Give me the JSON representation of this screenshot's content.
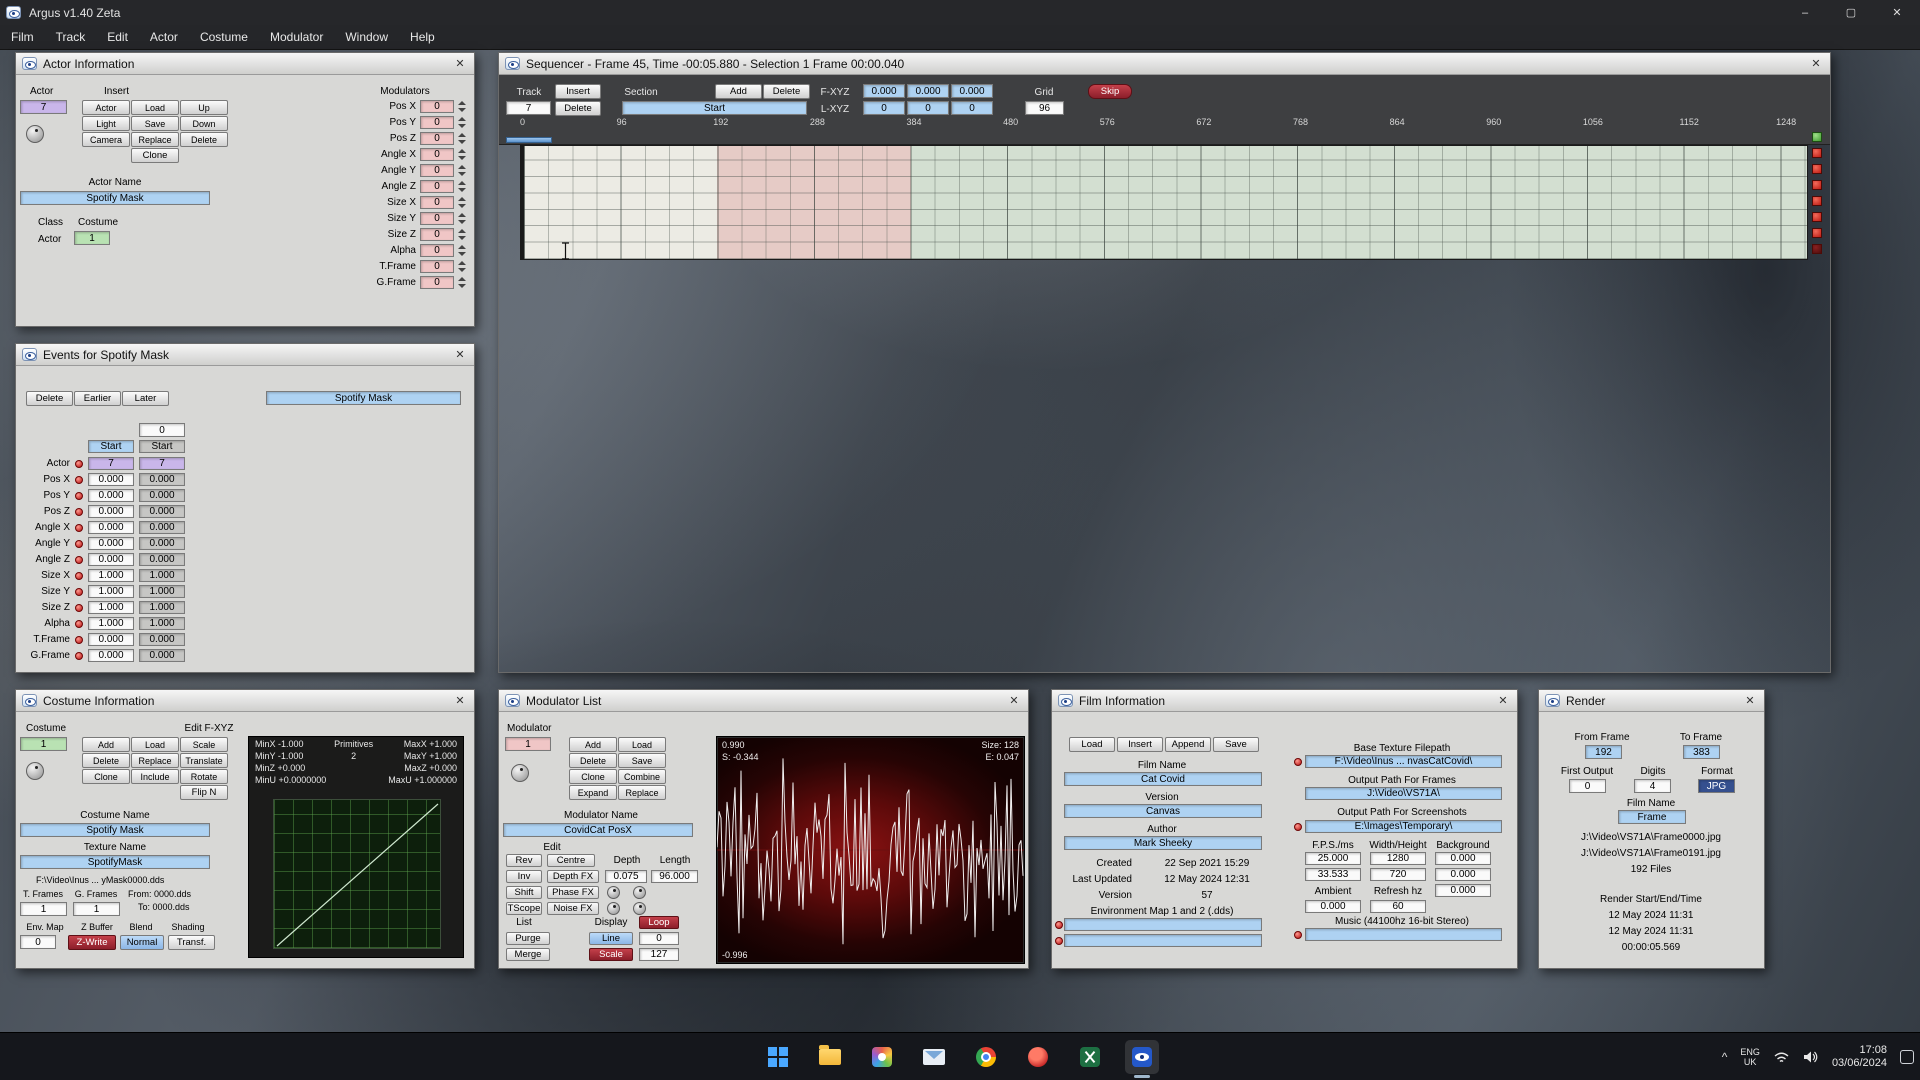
{
  "ui": {
    "close": "✕",
    "min": "–",
    "max": "▢",
    "chevron": "^"
  },
  "app": {
    "title": "Argus v1.40 Zeta",
    "menus": [
      "Film",
      "Track",
      "Edit",
      "Actor",
      "Costume",
      "Modulator",
      "Window",
      "Help"
    ]
  },
  "colors": {
    "field_blue": "#aed2f2",
    "field_pink": "#f0c6c6",
    "field_purple": "#c9b6ea",
    "field_green": "#b9e2b3",
    "button_red": "#a32430",
    "button_navy": "#35508f",
    "led_red": "#d42222"
  },
  "actor_info": {
    "title": "Actor Information",
    "actor_label": "Actor",
    "actor_value": "7",
    "insert_label": "Insert",
    "insert_buttons": [
      "Actor",
      "Load",
      "Up",
      "Light",
      "Save",
      "Down",
      "Camera",
      "Replace",
      "Delete"
    ],
    "clone_button": "Clone",
    "actor_name_label": "Actor Name",
    "actor_name_value": "Spotify Mask",
    "class_label": "Class",
    "costume_label": "Costume",
    "class_value": "Actor",
    "costume_value": "1",
    "modulators_label": "Modulators",
    "modulators": [
      {
        "label": "Pos X",
        "value": "0"
      },
      {
        "label": "Pos Y",
        "value": "0"
      },
      {
        "label": "Pos Z",
        "value": "0"
      },
      {
        "label": "Angle X",
        "value": "0"
      },
      {
        "label": "Angle Y",
        "value": "0"
      },
      {
        "label": "Angle Z",
        "value": "0"
      },
      {
        "label": "Size X",
        "value": "0"
      },
      {
        "label": "Size Y",
        "value": "0"
      },
      {
        "label": "Size Z",
        "value": "0"
      },
      {
        "label": "Alpha",
        "value": "0"
      },
      {
        "label": "T.Frame",
        "value": "0"
      },
      {
        "label": "G.Frame",
        "value": "0"
      }
    ]
  },
  "sequencer": {
    "title": "Sequencer - Frame 45, Time -00:05.880 - Selection 1 Frame 00:00.040",
    "track_label": "Track",
    "track_value": "7",
    "insert_button": "Insert",
    "delete_button": "Delete",
    "section_label": "Section",
    "section_value": "Start",
    "add_button": "Add",
    "delete_section_button": "Delete",
    "fxyz_label": "F-XYZ",
    "fxyz": [
      "0.000",
      "0.000",
      "0.000"
    ],
    "lxyz_label": "L-XYZ",
    "lxyz": [
      "0",
      "0",
      "0"
    ],
    "grid_label": "Grid",
    "grid_value": "96",
    "skip_button": "Skip",
    "ruler": [
      "0",
      "96",
      "192",
      "288",
      "384",
      "480",
      "576",
      "672",
      "768",
      "864",
      "960",
      "1056",
      "1152",
      "1248"
    ]
  },
  "events": {
    "title": "Events for Spotify Mask",
    "delete_button": "Delete",
    "earlier_button": "Earlier",
    "later_button": "Later",
    "mask_name": "Spotify Mask",
    "offset_value": "0",
    "col1_header": "Start",
    "col2_header": "Start",
    "actor_row": {
      "label": "Actor",
      "start1": "7",
      "start2": "7"
    },
    "rows": [
      {
        "label": "Pos X",
        "start1": "0.000",
        "start2": "0.000"
      },
      {
        "label": "Pos Y",
        "start1": "0.000",
        "start2": "0.000"
      },
      {
        "label": "Pos Z",
        "start1": "0.000",
        "start2": "0.000"
      },
      {
        "label": "Angle X",
        "start1": "0.000",
        "start2": "0.000"
      },
      {
        "label": "Angle Y",
        "start1": "0.000",
        "start2": "0.000"
      },
      {
        "label": "Angle Z",
        "start1": "0.000",
        "start2": "0.000"
      },
      {
        "label": "Size X",
        "start1": "1.000",
        "start2": "1.000"
      },
      {
        "label": "Size Y",
        "start1": "1.000",
        "start2": "1.000"
      },
      {
        "label": "Size Z",
        "start1": "1.000",
        "start2": "1.000"
      },
      {
        "label": "Alpha",
        "start1": "1.000",
        "start2": "1.000"
      },
      {
        "label": "T.Frame",
        "start1": "0.000",
        "start2": "0.000"
      },
      {
        "label": "G.Frame",
        "start1": "0.000",
        "start2": "0.000"
      }
    ]
  },
  "costume_info": {
    "title": "Costume Information",
    "costume_label": "Costume",
    "costume_value": "1",
    "buttons": [
      "Add",
      "Load",
      "Scale",
      "Delete",
      "Replace",
      "Translate",
      "Clone",
      "Include",
      "Rotate"
    ],
    "flip_button": "Flip N",
    "edit_label": "Edit F-XYZ",
    "bounds": {
      "minx": "MinX -1.000",
      "primitives_label": "Primitives",
      "maxx": "MaxX +1.000",
      "miny": "MinY -1.000",
      "primitives_value": "2",
      "maxy": "MaxY +1.000",
      "minz": "MinZ +0.000",
      "maxz": "MaxZ +0.000",
      "minu": "MinU +0.0000000",
      "maxu": "MaxU +1.000000"
    },
    "costume_name_label": "Costume Name",
    "costume_name_value": "Spotify Mask",
    "texture_name_label": "Texture Name",
    "texture_name_value": "SpotifyMask",
    "texture_path": "F:\\Video\\Inus ... yMask0000.dds",
    "t_frames_label": "T. Frames",
    "g_frames_label": "G. Frames",
    "from_label": "From: 0000.dds",
    "to_label": "To: 0000.dds",
    "t_frames_value": "1",
    "g_frames_value": "1",
    "env_map_label": "Env. Map",
    "z_buffer_label": "Z Buffer",
    "blend_label": "Blend",
    "shading_label": "Shading",
    "env_map_value": "0",
    "z_write_button": "Z-Write",
    "normal_button": "Normal",
    "transf_button": "Transf."
  },
  "modulator_list": {
    "title": "Modulator List",
    "modulator_label": "Modulator",
    "modulator_value": "1",
    "buttons": [
      "Add",
      "Load",
      "Delete",
      "Save",
      "Clone",
      "Combine",
      "Expand",
      "Replace"
    ],
    "modulator_name_label": "Modulator Name",
    "modulator_name_value": "CovidCat PosX",
    "edit_label": "Edit",
    "rev_button": "Rev",
    "centre_button": "Centre",
    "depth_label": "Depth",
    "length_label": "Length",
    "inv_button": "Inv",
    "depth_fx_button": "Depth FX",
    "depth_value": "0.075",
    "length_value": "96.000",
    "shift_button": "Shift",
    "phase_fx_button": "Phase FX",
    "tscope_button": "TScope",
    "noise_fx_button": "Noise FX",
    "list_label": "List",
    "display_label": "Display",
    "loop_button": "Loop",
    "purge_button": "Purge",
    "line_button": "Line",
    "line_value": "0",
    "merge_button": "Merge",
    "scale_button": "Scale",
    "scale_value": "127",
    "wave": {
      "top": "0.990",
      "start": "S: -0.344",
      "size": "Size: 128",
      "end": "E: 0.047",
      "bottom": "-0.996"
    }
  },
  "film_info": {
    "title": "Film Information",
    "buttons": [
      "Load",
      "Insert",
      "Append",
      "Save"
    ],
    "film_name_label": "Film Name",
    "film_name_value": "Cat Covid",
    "version_name_label": "Version",
    "version_name_value": "Canvas",
    "author_label": "Author",
    "author_value": "Mark Sheeky",
    "created_label": "Created",
    "created_value": "22 Sep 2021 15:29",
    "updated_label": "Last Updated",
    "updated_value": "12 May 2024 12:31",
    "version_label": "Version",
    "version_value": "57",
    "env_map_label": "Environment Map 1 and 2 (.dds)",
    "base_texture_label": "Base Texture Filepath",
    "base_texture_value": "F:\\Video\\Inus ... nvasCatCovid\\",
    "frames_path_label": "Output Path For Frames",
    "frames_path_value": "J:\\Video\\VS71A\\",
    "screenshots_path_label": "Output Path For Screenshots",
    "screenshots_path_value": "E:\\Images\\Temporary\\",
    "fps_label": "F.P.S./ms",
    "size_label": "Width/Height",
    "background_label": "Background",
    "fps_value": "25.000",
    "width_value": "1280",
    "bg1_value": "0.000",
    "ms_value": "33.533",
    "height_value": "720",
    "bg2_value": "0.000",
    "ambient_label": "Ambient",
    "refresh_label": "Refresh hz",
    "bg3_value": "0.000",
    "ambient_value": "0.000",
    "refresh_value": "60",
    "music_label": "Music (44100hz 16-bit Stereo)"
  },
  "render": {
    "title": "Render",
    "from_label": "From Frame",
    "to_label": "To Frame",
    "from_value": "192",
    "to_value": "383",
    "first_output_label": "First Output",
    "digits_label": "Digits",
    "format_label": "Format",
    "first_output_value": "0",
    "digits_value": "4",
    "format_value": "JPG",
    "film_name_label": "Film Name",
    "film_name_value": "Frame",
    "path1": "J:\\Video\\VS71A\\Frame0000.jpg",
    "path2": "J:\\Video\\VS71A\\Frame0191.jpg",
    "files_count": "192 Files",
    "render_label": "Render Start/End/Time",
    "start_time": "12 May 2024 11:31",
    "end_time": "12 May 2024 11:31",
    "duration": "00:00:05.569"
  },
  "taskbar": {
    "lang1": "ENG",
    "lang2": "UK",
    "time": "17:08",
    "date": "03/06/2024"
  }
}
